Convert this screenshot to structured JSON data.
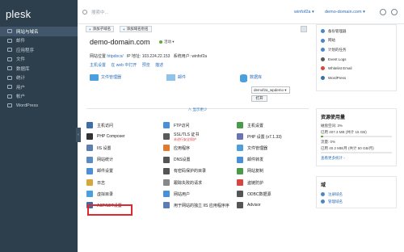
{
  "app": {
    "logo": "plesk"
  },
  "sidebar": {
    "items": [
      {
        "label": "网站与域名",
        "active": true
      },
      {
        "label": "邮件"
      },
      {
        "label": "应用程序"
      },
      {
        "label": "文件"
      },
      {
        "label": "数据库"
      },
      {
        "label": "统计"
      },
      {
        "label": "用户"
      },
      {
        "label": "帐户"
      },
      {
        "label": "WordPress"
      }
    ]
  },
  "topbar": {
    "search_placeholder": "搜索中...",
    "user": "winfof2a ▾",
    "domain": "demo-domain.com ▾"
  },
  "toolbar": {
    "add_subdomain": "添加子域名",
    "add_alias": "添加域名别名"
  },
  "domain": {
    "title": "demo-domain.com",
    "status": "活动 ▾",
    "site_location_label": "网站位置",
    "site_location_value": "httpdocs/",
    "ip_label": "IP 地址:",
    "ip_value": "103.224.22.153",
    "system_user_label": "系统用户:",
    "system_user_value": "winfof2a",
    "links": [
      "主机设置",
      "在 web 中打开",
      "预览",
      "描述"
    ]
  },
  "tiles": {
    "file_manager": "文件管理器",
    "mail": "邮件",
    "databases": "数据库",
    "db_select": "demof2a_wpdemo ▾",
    "db_button": "打开"
  },
  "show_less": "∧ 显示更少",
  "tools": [
    {
      "label": "主机访问",
      "color": "#3d6ea6"
    },
    {
      "label": "FTP访问",
      "color": "#4a90d9"
    },
    {
      "label": "主机设置",
      "color": "#4b9a4a"
    },
    {
      "label": "PHP Composer",
      "color": "#333333"
    },
    {
      "label": "SSL/TLS 证书",
      "sub": "未进行安全保护",
      "color": "#5a5a5a"
    },
    {
      "label": "PHP 设置 (v7.1.33)",
      "color": "#6b72b5"
    },
    {
      "label": "IIS 设置",
      "color": "#5a7fb0"
    },
    {
      "label": "应用程序",
      "color": "#e07a2e"
    },
    {
      "label": "文件管理器",
      "color": "#4aa0df"
    },
    {
      "label": "网站统计",
      "color": "#5b8cc3"
    },
    {
      "label": "DNS设置",
      "color": "#555555"
    },
    {
      "label": "邮件转发",
      "color": "#4a90d9"
    },
    {
      "label": "邮件设置",
      "color": "#4a90d9"
    },
    {
      "label": "有密码保护的目录",
      "color": "#555555"
    },
    {
      "label": "网站复制",
      "color": "#4b9a4a"
    },
    {
      "label": "日志",
      "color": "#d9a63a"
    },
    {
      "label": "跟踪失败的请求",
      "color": "#888888"
    },
    {
      "label": "盗链防护",
      "color": "#d9443e"
    },
    {
      "label": "虚拟目录",
      "color": "#4aa0df"
    },
    {
      "label": "网站用户",
      "color": "#4a90d9"
    },
    {
      "label": "ODBC数据源",
      "color": "#555555"
    },
    {
      "label": "ASP.NET设置",
      "color": "#3d6ea6"
    },
    {
      "label": "用于网站的独立 IIS 应用程序序",
      "color": "#5a7fb0"
    },
    {
      "label": "Advisor",
      "color": "#555555"
    }
  ],
  "right_panel": {
    "links": [
      {
        "label": "备份管理器",
        "color": "#4b86c6"
      },
      {
        "label": "网站",
        "color": "#4b86c6"
      },
      {
        "label": "计划的任务",
        "color": "#4b86c6"
      },
      {
        "label": "Event Logs",
        "color": "#5a5a5a"
      },
      {
        "label": "Whitelist Email",
        "color": "#d9443e"
      },
      {
        "label": "WordPress",
        "color": "#3a6fa8"
      }
    ],
    "resource_title": "资源使用量",
    "disk_label": "磁盘空间: 3%",
    "disk_detail": "已用 407.3 MB (共计 15 GB)",
    "traffic_label": "流量: 0%",
    "traffic_detail": "已用 40.2 MB/月 (共计 50 GB/月)",
    "more_link": "查看更多统计 ›",
    "domains_title": "域",
    "domain_links": [
      "注册域名",
      "管理域名"
    ],
    "disk_pct": 3,
    "traffic_pct": 0
  }
}
